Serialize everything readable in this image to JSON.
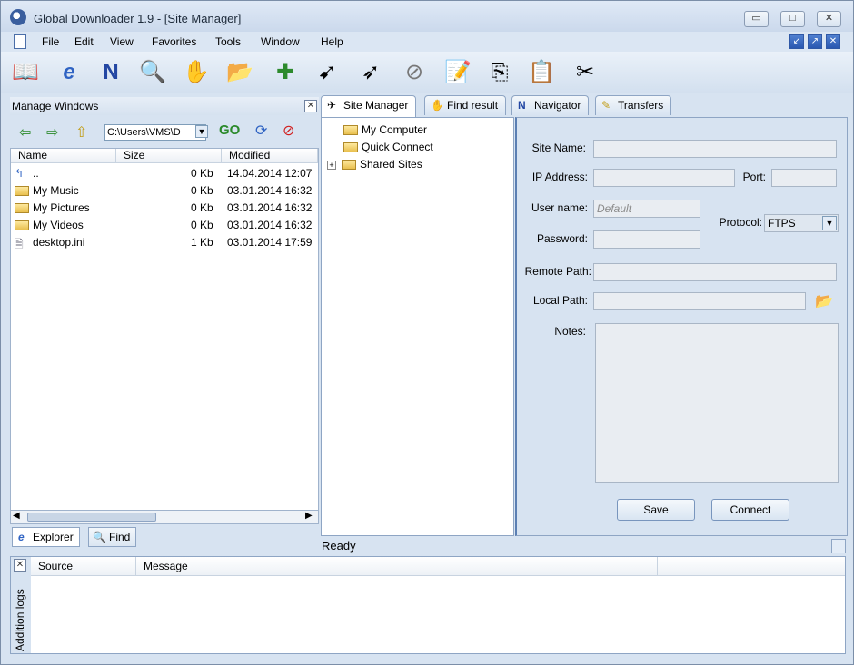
{
  "window": {
    "title": "Global Downloader 1.9 - [Site Manager]"
  },
  "menu": [
    "File",
    "Edit",
    "View",
    "Favorites",
    "Tools",
    "Window",
    "Help"
  ],
  "toolbar_icons": [
    "open-book-icon",
    "ie-icon",
    "netscape-icon",
    "search-icon",
    "hand-icon",
    "folder-add-icon",
    "add-download-icon",
    "start-icon",
    "start-all-icon",
    "stop-icon",
    "new-note-icon",
    "copy-icon",
    "paste-icon",
    "options-icon"
  ],
  "left_panel": {
    "title": "Manage Windows",
    "path": "C:\\Users\\VMS\\D",
    "columns": [
      "Name",
      "Size",
      "Modified"
    ],
    "files": [
      {
        "name": "..",
        "size": "0 Kb",
        "modified": "14.04.2014 12:07",
        "icon": "up-icon"
      },
      {
        "name": "My Music",
        "size": "0 Kb",
        "modified": "03.01.2014 16:32",
        "icon": "folder-icon"
      },
      {
        "name": "My Pictures",
        "size": "0 Kb",
        "modified": "03.01.2014 16:32",
        "icon": "folder-icon"
      },
      {
        "name": "My Videos",
        "size": "0 Kb",
        "modified": "03.01.2014 16:32",
        "icon": "folder-icon"
      },
      {
        "name": "desktop.ini",
        "size": "1 Kb",
        "modified": "03.01.2014 17:59",
        "icon": "file-icon"
      }
    ],
    "bottom_tabs": [
      "Explorer",
      "Find"
    ]
  },
  "tabs": [
    "Site Manager",
    "Find result",
    "Navigator",
    "Transfers"
  ],
  "tree": [
    "My Computer",
    "Quick Connect",
    "Shared Sites"
  ],
  "form": {
    "site_name_label": "Site Name:",
    "ip_label": "IP Address:",
    "port_label": "Port:",
    "user_label": "User name:",
    "user_placeholder": "Default",
    "password_label": "Password:",
    "protocol_label": "Protocol:",
    "protocol_value": "FTPS",
    "remote_label": "Remote Path:",
    "local_label": "Local Path:",
    "notes_label": "Notes:",
    "save": "Save",
    "connect": "Connect"
  },
  "status": "Ready",
  "log": {
    "side_title": "Addition logs",
    "columns": [
      "Source",
      "Message"
    ]
  }
}
